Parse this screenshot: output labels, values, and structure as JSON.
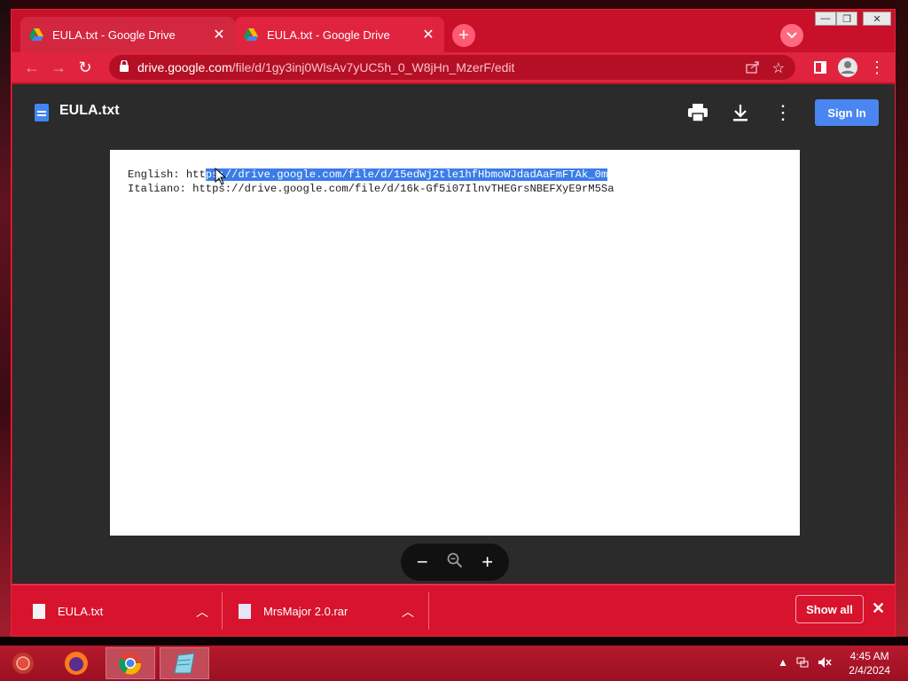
{
  "tabs": [
    {
      "title": "EULA.txt - Google Drive",
      "active": false
    },
    {
      "title": "EULA.txt - Google Drive",
      "active": true
    }
  ],
  "address": {
    "host": "drive.google.com",
    "path": "/file/d/1gy3inj0WlsAv7yUC5h_0_W8jHn_MzerF/edit"
  },
  "viewer": {
    "doc_title": "EULA.txt",
    "sign_in_label": "Sign In",
    "lines": [
      {
        "label": "English: ",
        "url_pre": "htt",
        "url_sel": "ps://drive.google.com/file/d/15edWj2tle1hfHbmoWJdadAaFmFTAk_0m"
      },
      {
        "label": "Italiano: ",
        "url": "https://drive.google.com/file/d/16k-Gf5i07IlnvTHEGrsNBEFXyE9rM5Sa"
      }
    ]
  },
  "zoom": {
    "minus": "−",
    "plus": "+"
  },
  "downloads": {
    "items": [
      {
        "name": "EULA.txt"
      },
      {
        "name": "MrsMajor 2.0.rar"
      }
    ],
    "show_all_label": "Show all"
  },
  "taskbar": {
    "time": "4:45 AM",
    "date": "2/4/2024"
  },
  "colors": {
    "chrome_frame": "#c8102b",
    "viewer_bg": "#2b2b2b",
    "signin_blue": "#4a86f2",
    "selection": "#3b7de8"
  }
}
